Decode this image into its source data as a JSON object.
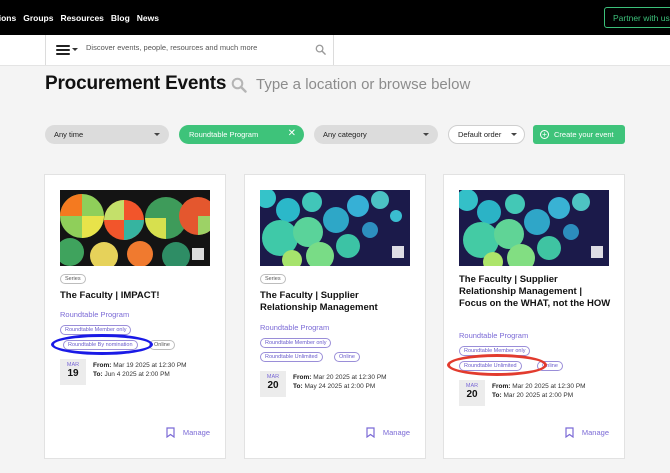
{
  "nav": {
    "links": [
      "sions",
      "Groups",
      "Resources",
      "Blog",
      "News"
    ],
    "partner_button": "Partner with us"
  },
  "search": {
    "placeholder": "Discover events, people, resources and much more"
  },
  "page": {
    "title": "Procurement Events",
    "location_prompt": "Type a location or browse below"
  },
  "filters": {
    "time": "Any time",
    "program": "Roundtable Program",
    "category": "Any category",
    "order": "Default order",
    "create_button": "Create your event"
  },
  "cards": [
    {
      "series": "Series",
      "title": "The Faculty | IMPACT!",
      "org": "Roundtable Program",
      "tags": [
        "Roundtable Member only",
        "Roundtable By nomination",
        "Online"
      ],
      "month": "MAR",
      "day": "19",
      "from_label": "From:",
      "from": "Mar 19 2025 at 12:30 PM",
      "to_label": "To:",
      "to": "Jun 4 2025 at 2:00 PM",
      "manage": "Manage"
    },
    {
      "series": "Series",
      "title": "The Faculty | Supplier Relationship Management",
      "org": "Roundtable Program",
      "tags": [
        "Roundtable Member only",
        "Roundtable Unlimited",
        "Online"
      ],
      "month": "MAR",
      "day": "20",
      "from_label": "From:",
      "from": "Mar 20 2025 at 12:30 PM",
      "to_label": "To:",
      "to": "May 24 2025 at 2:00 PM",
      "manage": "Manage"
    },
    {
      "title": "The Faculty | Supplier Relationship Management | Focus on the WHAT, not the HOW",
      "org": "Roundtable Program",
      "tags": [
        "Roundtable Member only",
        "Roundtable Unlimited",
        "Online"
      ],
      "month": "MAR",
      "day": "20",
      "from_label": "From:",
      "from": "Mar 20 2025 at 12:30 PM",
      "to_label": "To:",
      "to": "Mar 20 2025 at 2:00 PM",
      "manage": "Manage"
    }
  ],
  "annotations": {
    "blue": "#1a1ae6",
    "red": "#e23b2e"
  },
  "colors": {
    "accent": "#3ec37a",
    "link": "#7b6ad6"
  }
}
